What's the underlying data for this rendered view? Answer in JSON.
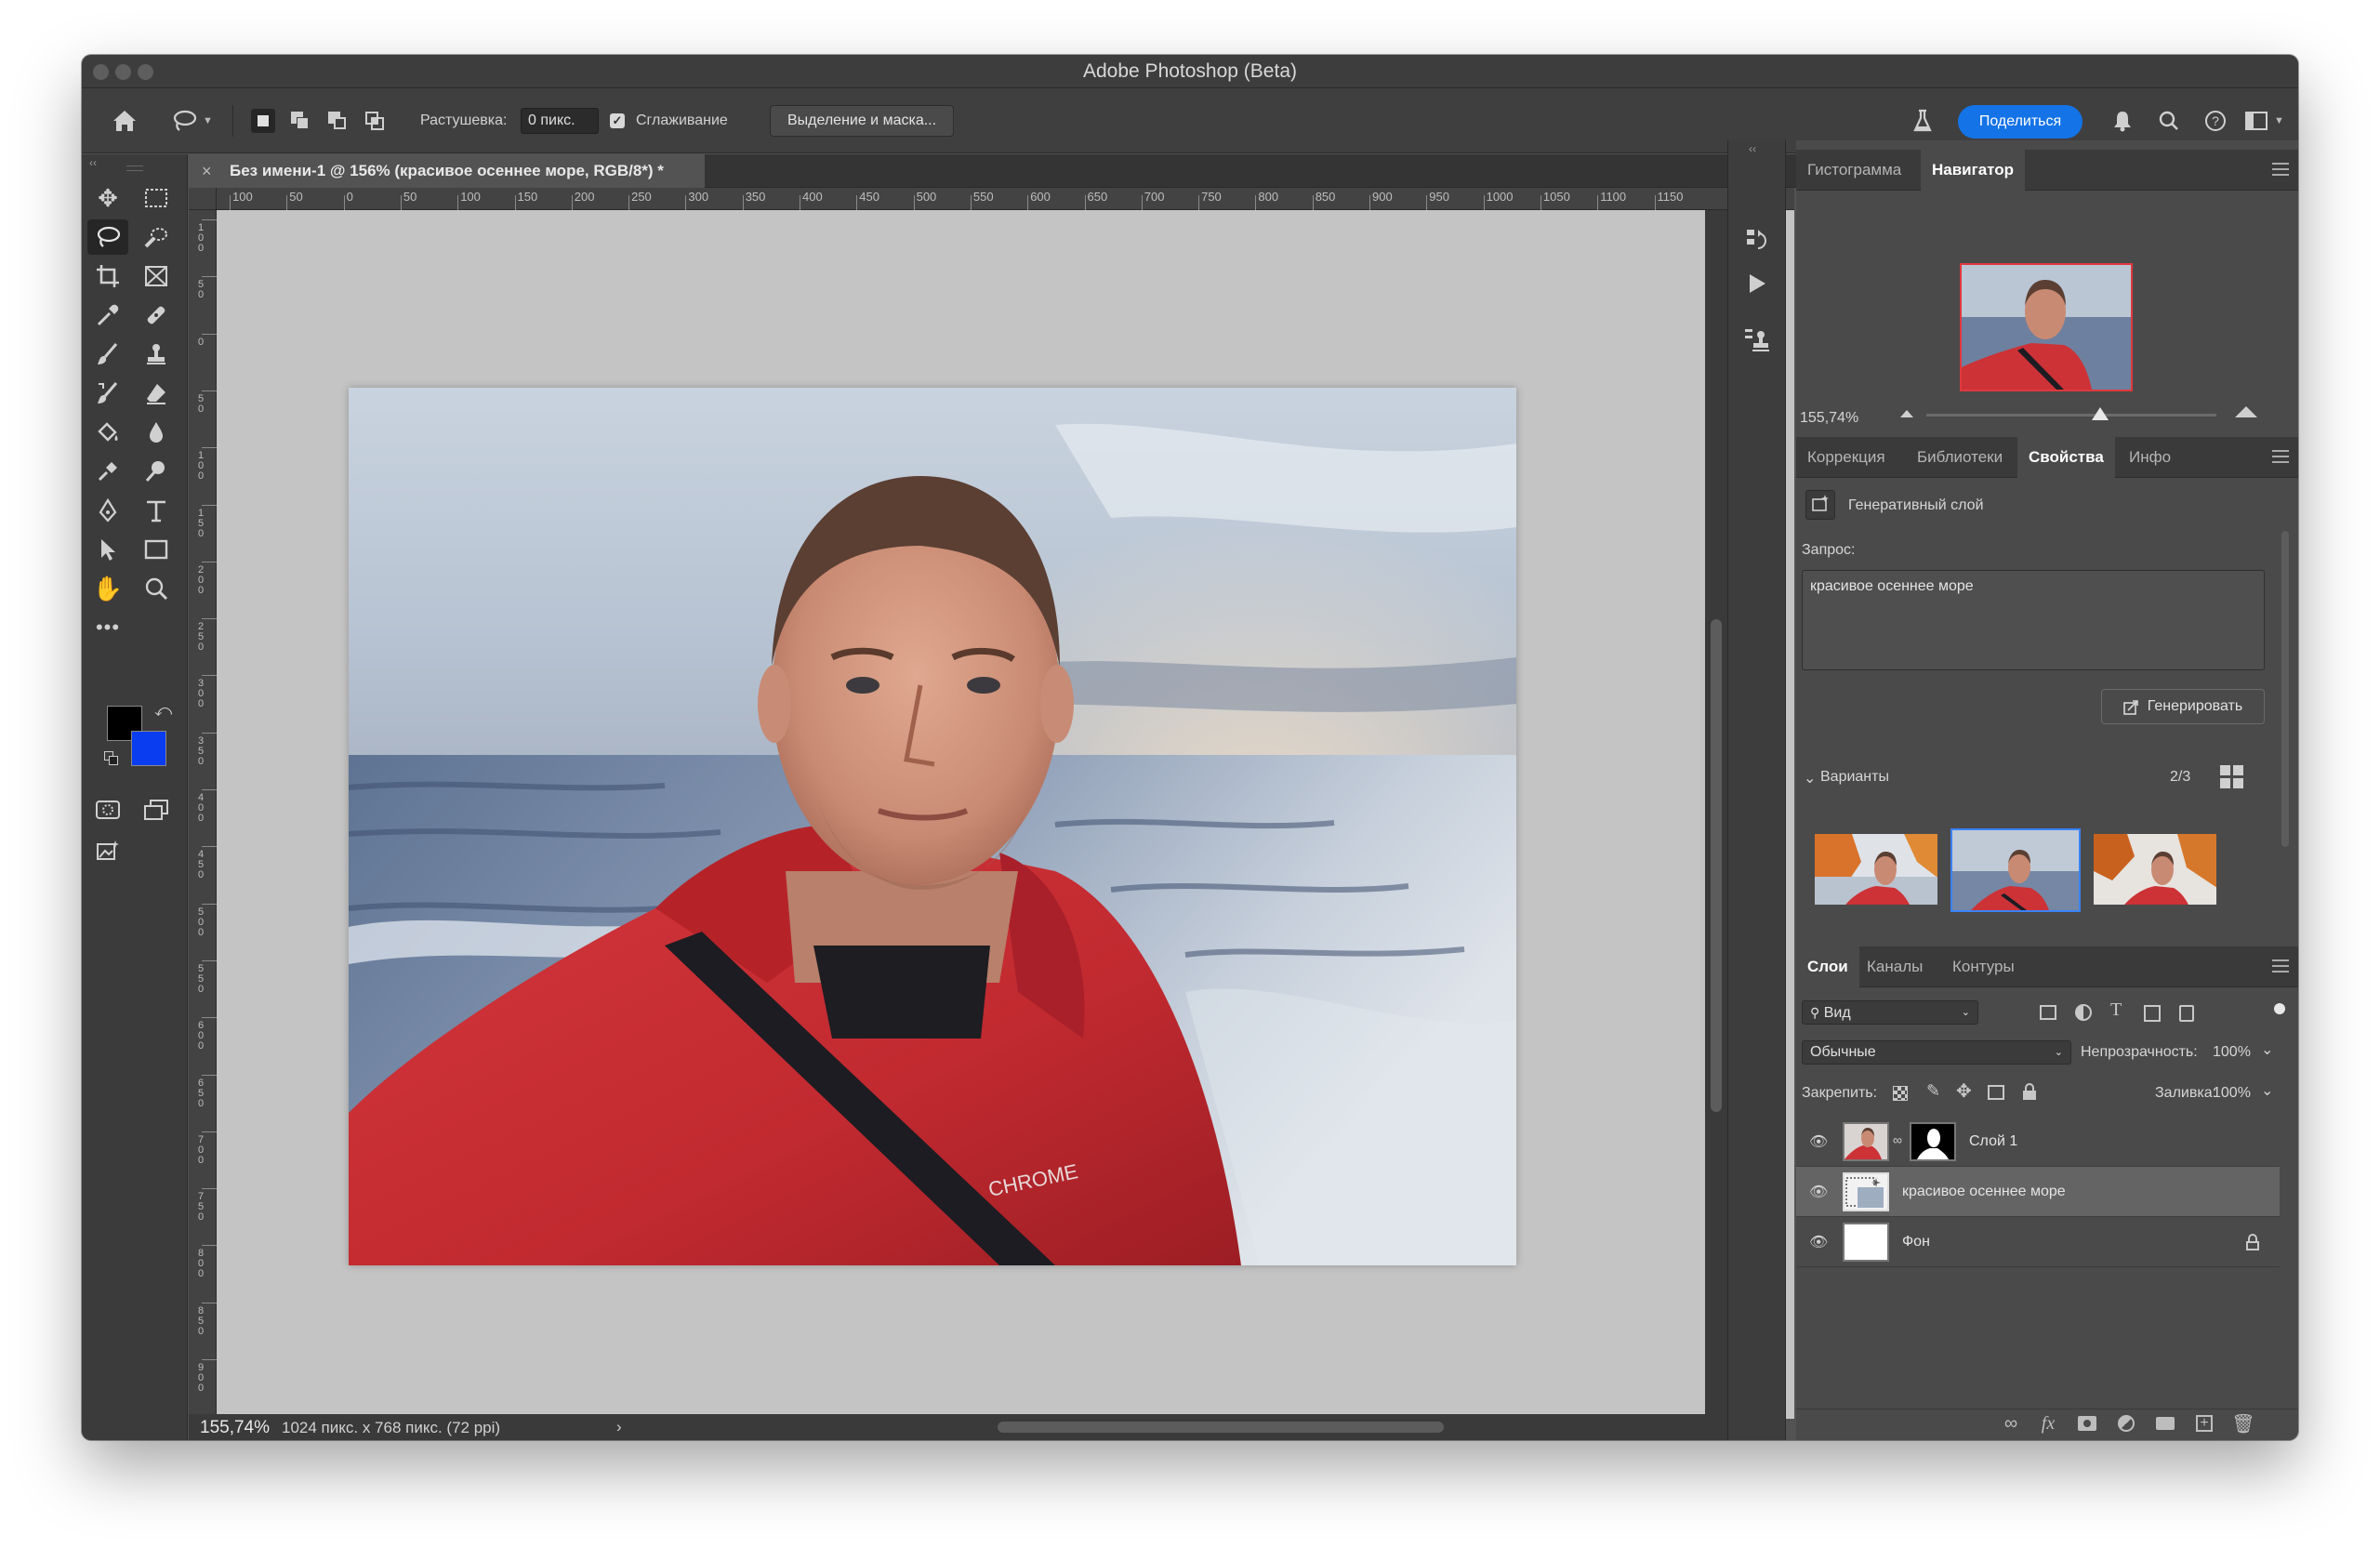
{
  "app": {
    "title": "Adobe Photoshop (Beta)"
  },
  "options": {
    "feather_label": "Растушевка:",
    "feather_value": "0 пикс.",
    "antialias_label": "Сглаживание",
    "select_mask_label": "Выделение и маска...",
    "share_label": "Поделиться"
  },
  "document": {
    "tab_title": "Без имени-1 @ 156% (красивое осеннее море, RGB/8*) *",
    "ruler_ticks": [
      "100",
      "50",
      "0",
      "50",
      "100",
      "150",
      "200",
      "250",
      "300",
      "350",
      "400",
      "450",
      "500",
      "550",
      "600",
      "650",
      "700",
      "750",
      "800",
      "850",
      "900",
      "950",
      "1000",
      "1050",
      "1100",
      "1150"
    ],
    "ruler_v_ticks": [
      "1 0 0",
      "5 0",
      "0",
      "5 0",
      "1 0 0",
      "1 5 0",
      "2 0 0",
      "2 5 0",
      "3 0 0",
      "3 5 0",
      "4 0 0",
      "4 5 0",
      "5 0 0",
      "5 5 0",
      "6 0 0",
      "6 5 0",
      "7 0 0",
      "7 5 0",
      "8 0 0",
      "8 5 0",
      "9 0 0"
    ],
    "zoom": "155,74%",
    "doc_info": "1024 пикс. x 768 пикс. (72 ppi)",
    "shirt_text": "CHROME"
  },
  "colors": {
    "foreground": "#000000",
    "background": "#0a3cf0",
    "accent": "#1473e6",
    "selection_border": "#3a82f7"
  },
  "navigator": {
    "tabs": [
      "Гистограмма",
      "Навигатор"
    ],
    "active_tab": "Навигатор",
    "zoom": "155,74%",
    "zoom_level": 0.6
  },
  "properties": {
    "tabs": [
      "Коррекция",
      "Библиотеки",
      "Свойства",
      "Инфо"
    ],
    "active_tab": "Свойства",
    "layer_type": "Генеративный слой",
    "prompt_label": "Запрос:",
    "prompt_value": "красивое осеннее море",
    "generate_label": "Генерировать",
    "variants_label": "Варианты",
    "variants_count": "2/3",
    "selected_variant": 2
  },
  "layers": {
    "tabs": [
      "Слои",
      "Каналы",
      "Контуры"
    ],
    "active_tab": "Слои",
    "filter_label": "Вид",
    "blend_mode": "Обычные",
    "opacity_label": "Непрозрачность:",
    "opacity_value": "100%",
    "lock_label": "Закрепить:",
    "fill_label": "Заливка:",
    "fill_value": "100%",
    "items": [
      {
        "name": "Слой 1",
        "visible": true,
        "selected": false
      },
      {
        "name": "красивое осеннее море",
        "visible": true,
        "selected": true
      },
      {
        "name": "Фон",
        "visible": true,
        "selected": false,
        "locked": true
      }
    ]
  },
  "icons": [
    "home-icon",
    "lasso-icon",
    "flask-icon",
    "bell-icon",
    "search-icon",
    "help-icon",
    "workspace-icon",
    "move-tool-icon",
    "marquee-tool-icon",
    "crop-tool-icon",
    "eyedropper-icon",
    "brush-icon",
    "stamp-icon",
    "eraser-icon",
    "bucket-icon",
    "dodge-icon",
    "pen-icon",
    "type-icon",
    "path-select-icon",
    "rectangle-icon",
    "hand-icon",
    "zoom-icon",
    "more-tools-icon",
    "quick-mask-icon",
    "screen-mode-icon"
  ]
}
